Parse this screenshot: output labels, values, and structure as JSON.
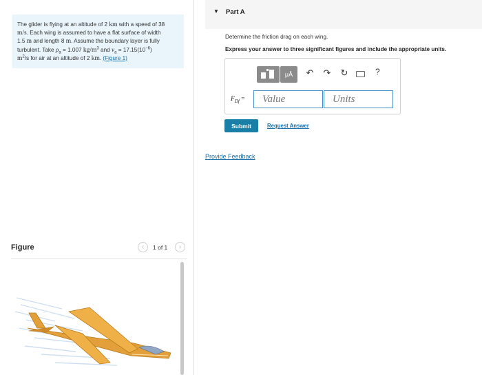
{
  "problem": {
    "line1": "The glider is flying at an altitude of 2 ",
    "line1_unit": "km",
    "line1_b": " with a speed of 38",
    "line2_unit": "m/s",
    "line2": ". Each wing is assumed to have a flat surface of width",
    "line3_num": "1.5 ",
    "line3_unit": "m",
    "line3": " and length 8 ",
    "line3_unit2": "m",
    "line3_b": ". Assume the boundary layer is fully",
    "line4_a": "turbulent. Take ",
    "rho_symbol": "ρ",
    "rho_sub": "a",
    "line4_b": " = 1.007 ",
    "rho_unit": "kg/m",
    "rho_unit_sup": "3",
    "line4_c": " and ",
    "nu_symbol": "ν",
    "nu_sub": "a",
    "line4_d": " = 17.15(10",
    "nu_exp": "−6",
    "line4_e": ")",
    "nu_unit": "m",
    "nu_unit_sup": "2",
    "line5_a": "/s for air at an altitude of 2 ",
    "line5_unit": "km",
    "line5_b": ". ",
    "figure_link": "(Figure 1)"
  },
  "figure": {
    "title": "Figure",
    "counter": "1 of 1",
    "prev_icon": "chevron-left-icon",
    "next_icon": "chevron-right-icon"
  },
  "part": {
    "caret_icon": "caret-down-icon",
    "title": "Part A",
    "prompt": "Determine the friction drag on each wing.",
    "instruction": "Express your answer to three significant figures and include the appropriate units."
  },
  "answer": {
    "toolbar": {
      "units_label": "μÅ",
      "undo": "↶",
      "redo": "↷",
      "reset": "↻",
      "help": "?"
    },
    "var_symbol": "F",
    "var_sub": "Df",
    "var_eq": " =",
    "value_placeholder": "Value",
    "units_placeholder": "Units"
  },
  "actions": {
    "submit": "Submit",
    "request_answer": "Request Answer",
    "feedback": "Provide Feedback"
  },
  "colors": {
    "problem_bg": "#e9f5fb",
    "link": "#1c6fa7",
    "submit_bg": "#1a7fa6",
    "input_border": "#4a8ec7",
    "glider_body": "#e3a03a"
  }
}
